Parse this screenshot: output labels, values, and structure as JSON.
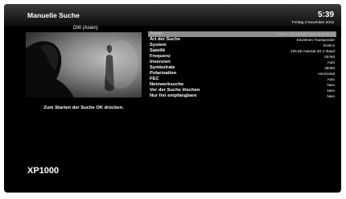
{
  "header": {
    "title": "Manuelle Suche",
    "time": "5:39",
    "date": "Freitag  2 November 2012"
  },
  "preview": {
    "channel_name": "DW (Asien)"
  },
  "hint": "Zum Starten der Suche OK drücken.",
  "settings": {
    "rows": [
      {
        "label": "Tuner",
        "value": "Tuner A: BCM7346 Internal DVB-S2"
      },
      {
        "label": "Art der Suche",
        "value": "Einzelnen Transponder"
      },
      {
        "label": "System",
        "value": "DVB-S"
      },
      {
        "label": "Satellit",
        "value": "105.5E AsiaSat 3S C Band"
      },
      {
        "label": "Frequenz",
        "value": "03760"
      },
      {
        "label": "Inversion",
        "value": "Auto"
      },
      {
        "label": "Symbolrate",
        "value": "26000"
      },
      {
        "label": "Polarisation",
        "value": "Horizontal"
      },
      {
        "label": "FEC",
        "value": "Auto"
      },
      {
        "label": "Netzwerksuche",
        "value": "Nein"
      },
      {
        "label": "Vor der Suche löschen",
        "value": "Nein"
      },
      {
        "label": "Nur frei empfangbare",
        "value": "Nein"
      }
    ],
    "selected_index": 0
  },
  "brand": "XP1000",
  "colors": {
    "screen_background": "#000000",
    "selected_row": "#8c8c8c",
    "text": "#ffffff"
  }
}
